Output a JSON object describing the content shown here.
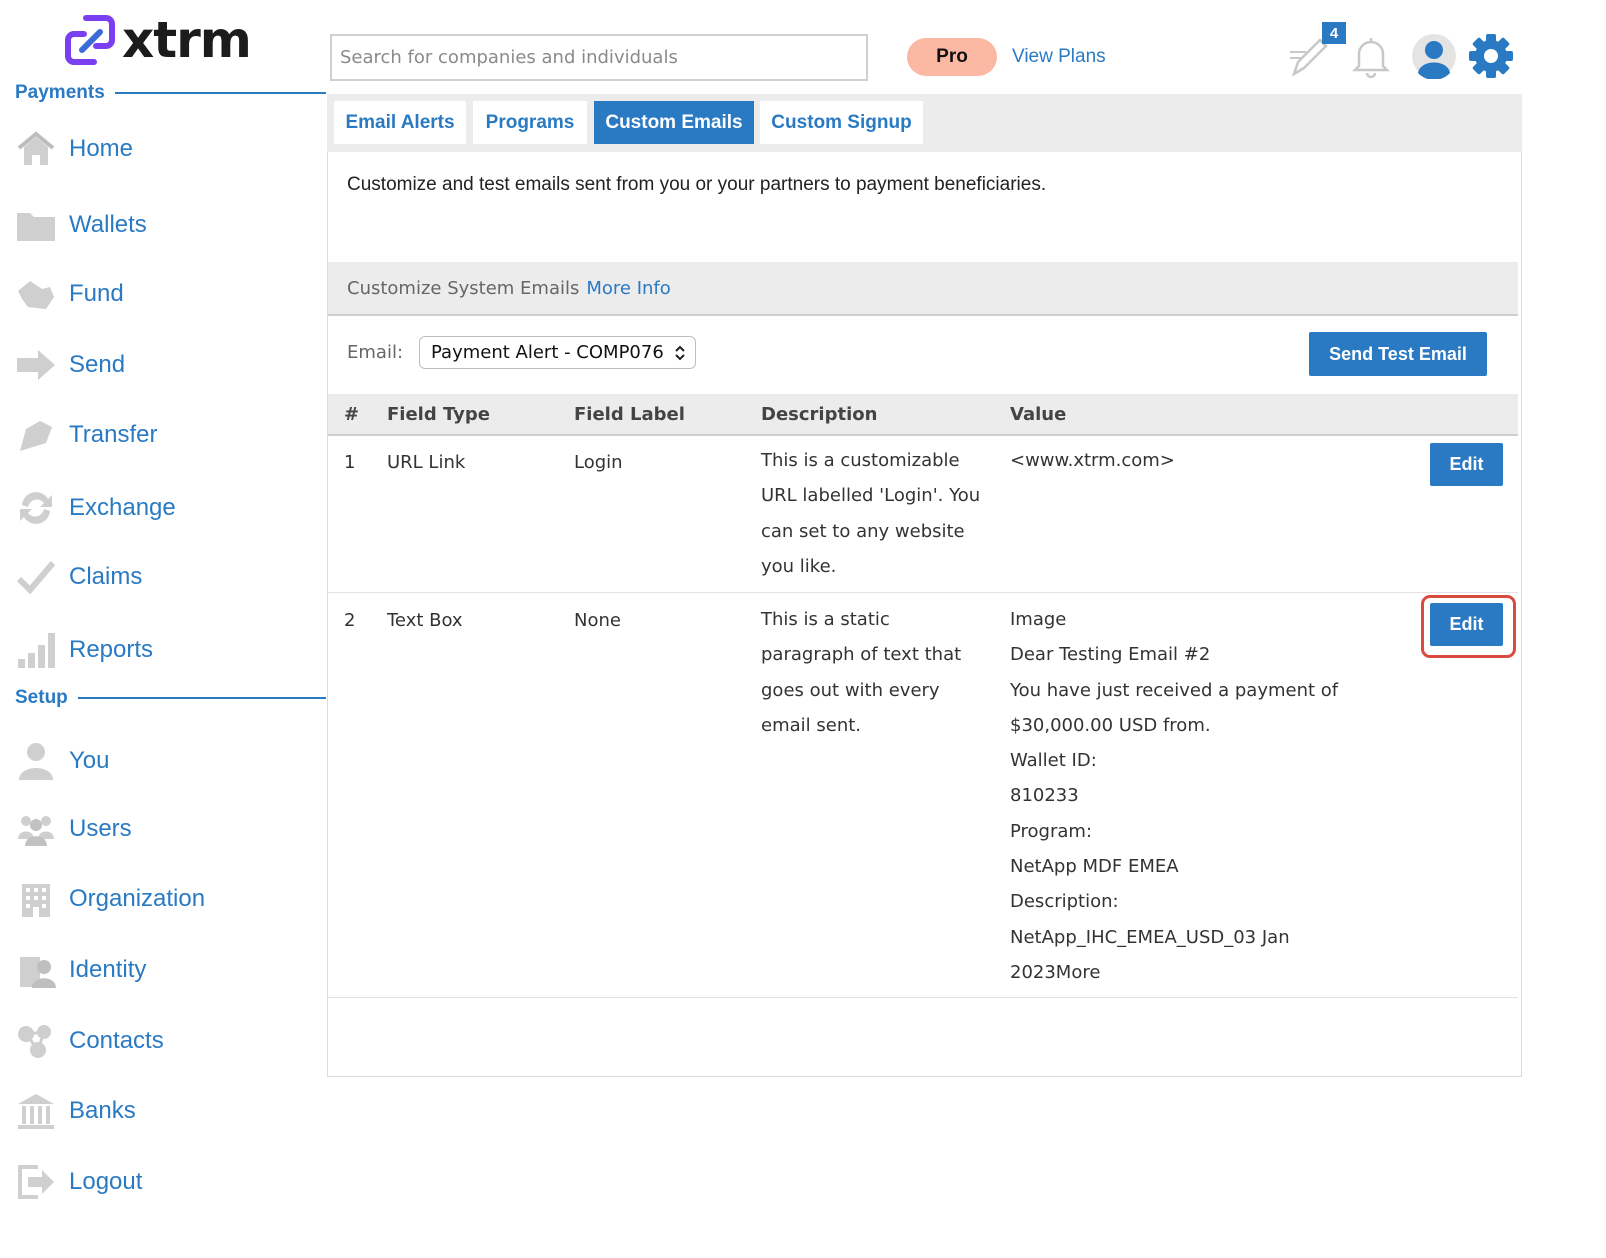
{
  "brand": {
    "name": "xtrm",
    "accent": "#2a7ac3",
    "logo_purple": "#7b3ff2"
  },
  "sidebar": {
    "sections": [
      {
        "title": "Payments"
      },
      {
        "title": "Setup"
      }
    ],
    "items": [
      {
        "label": "Home",
        "icon": "home-icon"
      },
      {
        "label": "Wallets",
        "icon": "folder-icon"
      },
      {
        "label": "Fund",
        "icon": "fund-icon"
      },
      {
        "label": "Send",
        "icon": "arrow-right-icon"
      },
      {
        "label": "Transfer",
        "icon": "transfer-icon"
      },
      {
        "label": "Exchange",
        "icon": "exchange-icon"
      },
      {
        "label": "Claims",
        "icon": "checkmark-icon"
      },
      {
        "label": "Reports",
        "icon": "bar-chart-icon"
      },
      {
        "label": "You",
        "icon": "person-icon"
      },
      {
        "label": "Users",
        "icon": "users-icon"
      },
      {
        "label": "Organization",
        "icon": "building-icon"
      },
      {
        "label": "Identity",
        "icon": "identity-icon"
      },
      {
        "label": "Contacts",
        "icon": "contacts-icon"
      },
      {
        "label": "Banks",
        "icon": "bank-icon"
      },
      {
        "label": "Logout",
        "icon": "logout-icon"
      }
    ]
  },
  "header": {
    "search_placeholder": "Search for companies and individuals",
    "plan_badge": "Pro",
    "view_plans": "View Plans",
    "notification_count": "4"
  },
  "tabs": [
    {
      "label": "Email Alerts",
      "active": false
    },
    {
      "label": "Programs",
      "active": false
    },
    {
      "label": "Custom Emails",
      "active": true
    },
    {
      "label": "Custom Signup",
      "active": false
    }
  ],
  "main": {
    "intro": "Customize and test emails sent from you or your partners to payment beneficiaries.",
    "subhead_title": "Customize System Emails",
    "subhead_link": "More Info",
    "email_label": "Email:",
    "email_selected": "Payment Alert - COMP076",
    "send_test_label": "Send Test Email",
    "columns": [
      "#",
      "Field Type",
      "Field Label",
      "Description",
      "Value"
    ],
    "rows": [
      {
        "num": "1",
        "type": "URL Link",
        "label": "Login",
        "description": [
          "This is a customizable",
          "URL labelled 'Login'. You",
          "can set to any website",
          "you like."
        ],
        "value": [
          "<www.xtrm.com>"
        ],
        "action": "Edit",
        "highlighted": false
      },
      {
        "num": "2",
        "type": "Text Box",
        "label": "None",
        "description": [
          "This is a static",
          "paragraph of text that",
          "goes out with every",
          "email sent."
        ],
        "value": [
          "Image",
          "Dear Testing Email #2",
          "You have just received a payment of",
          "$30,000.00 USD from.",
          "Wallet ID:",
          "810233",
          "Program:",
          "NetApp MDF EMEA",
          "Description:",
          "NetApp_IHC_EMEA_USD_03 Jan",
          "2023More"
        ],
        "action": "Edit",
        "highlighted": true
      }
    ]
  }
}
